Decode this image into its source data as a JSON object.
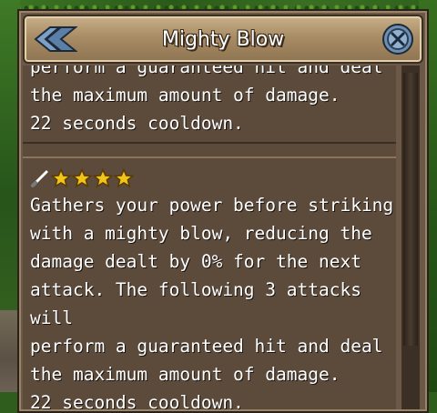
{
  "window": {
    "title": "Mighty Blow"
  },
  "entries": [
    {
      "text": "perform a guaranteed hit and deal\nthe maximum amount of damage.\n22 seconds cooldown."
    },
    {
      "rating": 4,
      "text": "Gathers your power before striking\nwith a mighty blow, reducing the\ndamage dealt by 0% for the next\nattack. The following 3 attacks will\nperform a guaranteed hit and deal\nthe maximum amount of damage.\n22 seconds cooldown."
    }
  ],
  "icons": {
    "back": "back-arrow-icon",
    "close": "close-icon",
    "weapon": "sword-icon",
    "rating": "star-icon"
  },
  "colors": {
    "star": "#f2c318",
    "panel": "#5c4b3b",
    "title_bar": "#a88c65"
  }
}
